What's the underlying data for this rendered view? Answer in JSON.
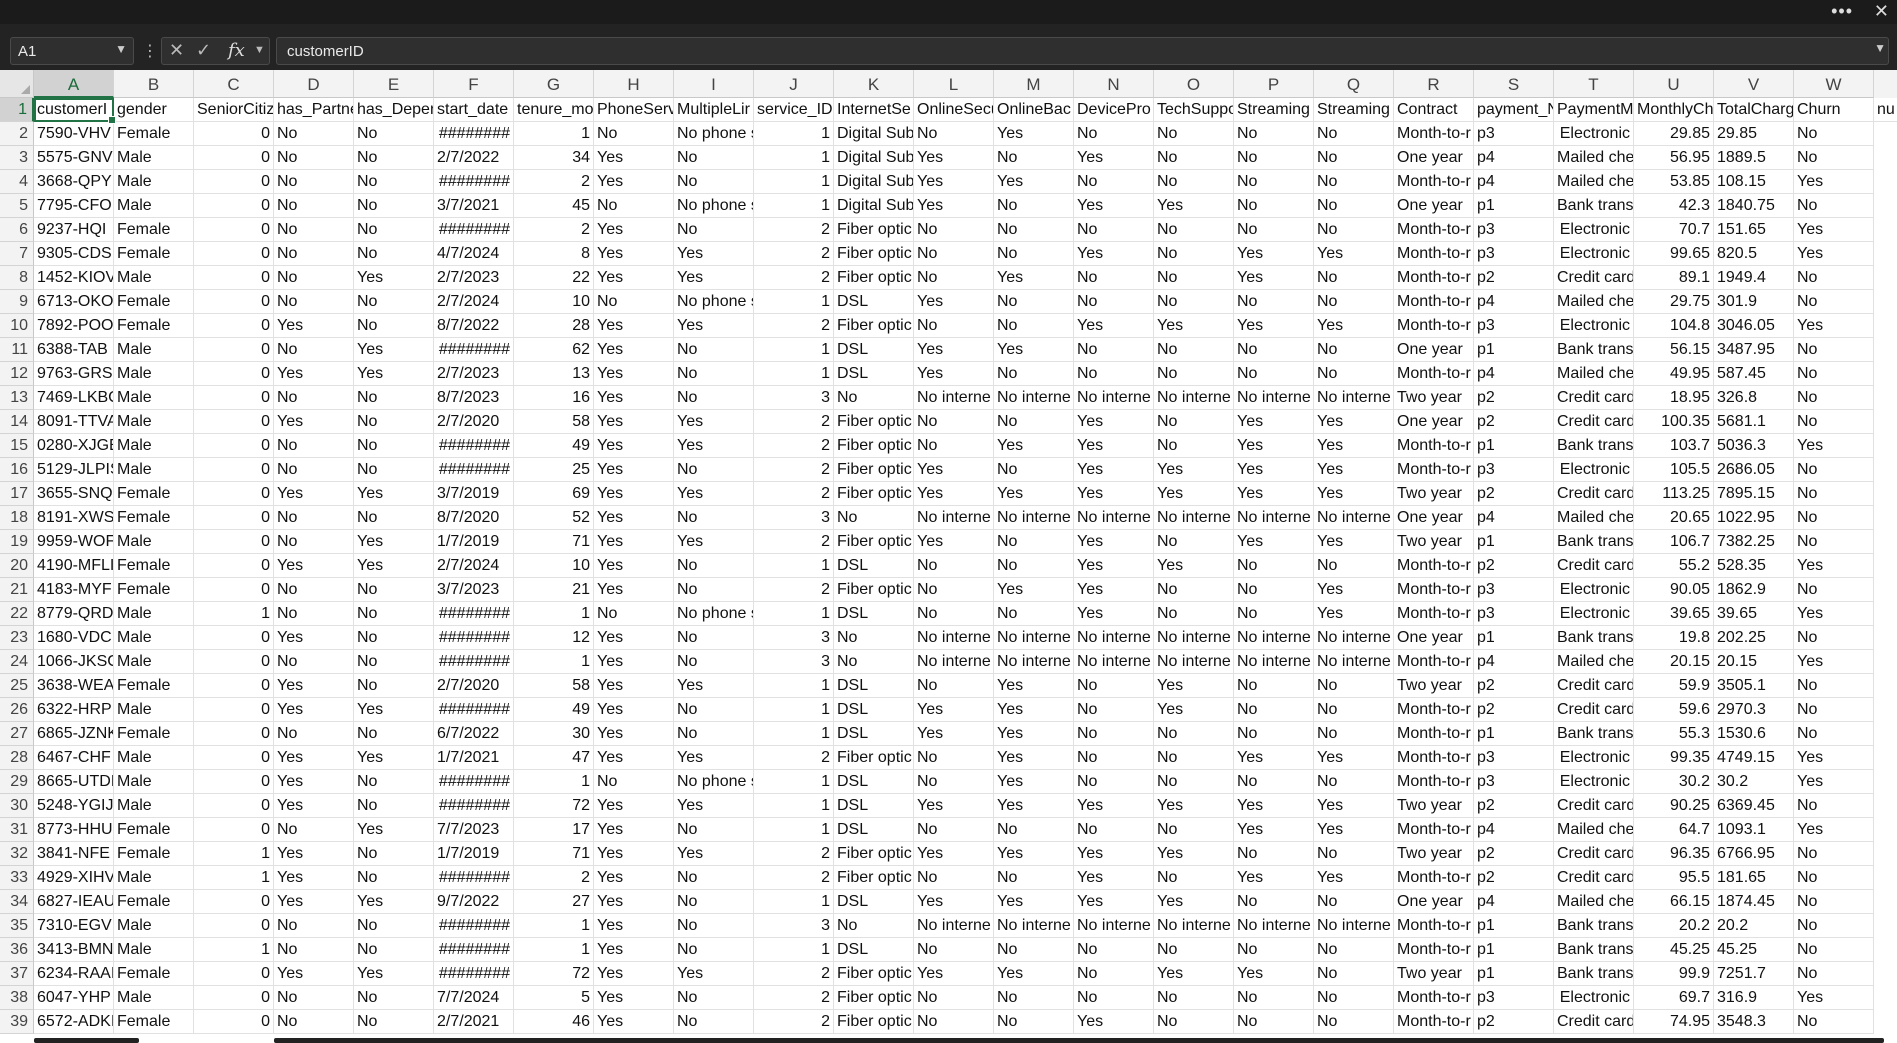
{
  "window": {
    "more_label": "•••",
    "close_label": "✕"
  },
  "formula_bar": {
    "name_box": "A1",
    "cancel_icon": "x-icon",
    "enter_icon": "check-icon",
    "function_label": "fx",
    "value": "customerID"
  },
  "columns": [
    "A",
    "B",
    "C",
    "D",
    "E",
    "F",
    "G",
    "H",
    "I",
    "J",
    "K",
    "L",
    "M",
    "N",
    "O",
    "P",
    "Q",
    "R",
    "S",
    "T",
    "U",
    "V",
    "W"
  ],
  "numeric_columns": [
    2,
    6,
    9,
    19,
    20
  ],
  "rows": [
    [
      "customerI",
      "gender",
      "SeniorCitiz",
      "has_Partne",
      "has_Deper",
      "start_date",
      "tenure_mo",
      "PhoneServ",
      "MultipleLir",
      "service_ID",
      "InternetSe",
      "OnlineSecu",
      "OnlineBac",
      "DevicePro",
      "TechSuppo",
      "Streaming",
      "Streaming",
      "Contract",
      "payment_N",
      "PaymentM",
      "MonthlyCh",
      "TotalCharg",
      "Churn",
      "nu"
    ],
    [
      "7590-VHV",
      "Female",
      "0",
      "No",
      "No",
      "########",
      "1",
      "No",
      "No phone s",
      "1",
      "Digital Sub",
      "No",
      "Yes",
      "No",
      "No",
      "No",
      "No",
      "Month-to-r",
      "p3",
      "Electronic",
      "29.85",
      "29.85",
      "No"
    ],
    [
      "5575-GNV",
      "Male",
      "0",
      "No",
      "No",
      "2/7/2022",
      "34",
      "Yes",
      "No",
      "1",
      "Digital Sub",
      "Yes",
      "No",
      "Yes",
      "No",
      "No",
      "No",
      "One year",
      "p4",
      "Mailed che",
      "56.95",
      "1889.5",
      "No"
    ],
    [
      "3668-QPYI",
      "Male",
      "0",
      "No",
      "No",
      "########",
      "2",
      "Yes",
      "No",
      "1",
      "Digital Sub",
      "Yes",
      "Yes",
      "No",
      "No",
      "No",
      "No",
      "Month-to-r",
      "p4",
      "Mailed che",
      "53.85",
      "108.15",
      "Yes"
    ],
    [
      "7795-CFO",
      "Male",
      "0",
      "No",
      "No",
      "3/7/2021",
      "45",
      "No",
      "No phone s",
      "1",
      "Digital Sub",
      "Yes",
      "No",
      "Yes",
      "Yes",
      "No",
      "No",
      "One year",
      "p1",
      "Bank trans",
      "42.3",
      "1840.75",
      "No"
    ],
    [
      "9237-HQI",
      "Female",
      "0",
      "No",
      "No",
      "########",
      "2",
      "Yes",
      "No",
      "2",
      "Fiber optic",
      "No",
      "No",
      "No",
      "No",
      "No",
      "No",
      "Month-to-r",
      "p3",
      "Electronic",
      "70.7",
      "151.65",
      "Yes"
    ],
    [
      "9305-CDSI",
      "Female",
      "0",
      "No",
      "No",
      "4/7/2024",
      "8",
      "Yes",
      "Yes",
      "2",
      "Fiber optic",
      "No",
      "No",
      "Yes",
      "No",
      "Yes",
      "Yes",
      "Month-to-r",
      "p3",
      "Electronic",
      "99.65",
      "820.5",
      "Yes"
    ],
    [
      "1452-KIOV",
      "Male",
      "0",
      "No",
      "Yes",
      "2/7/2023",
      "22",
      "Yes",
      "Yes",
      "2",
      "Fiber optic",
      "No",
      "Yes",
      "No",
      "No",
      "Yes",
      "No",
      "Month-to-r",
      "p2",
      "Credit card",
      "89.1",
      "1949.4",
      "No"
    ],
    [
      "6713-OKO",
      "Female",
      "0",
      "No",
      "No",
      "2/7/2024",
      "10",
      "No",
      "No phone s",
      "1",
      "DSL",
      "Yes",
      "No",
      "No",
      "No",
      "No",
      "No",
      "Month-to-r",
      "p4",
      "Mailed che",
      "29.75",
      "301.9",
      "No"
    ],
    [
      "7892-POO",
      "Female",
      "0",
      "Yes",
      "No",
      "8/7/2022",
      "28",
      "Yes",
      "Yes",
      "2",
      "Fiber optic",
      "No",
      "No",
      "Yes",
      "Yes",
      "Yes",
      "Yes",
      "Month-to-r",
      "p3",
      "Electronic",
      "104.8",
      "3046.05",
      "Yes"
    ],
    [
      "6388-TAB",
      "Male",
      "0",
      "No",
      "Yes",
      "########",
      "62",
      "Yes",
      "No",
      "1",
      "DSL",
      "Yes",
      "Yes",
      "No",
      "No",
      "No",
      "No",
      "One year",
      "p1",
      "Bank trans",
      "56.15",
      "3487.95",
      "No"
    ],
    [
      "9763-GRSI",
      "Male",
      "0",
      "Yes",
      "Yes",
      "2/7/2023",
      "13",
      "Yes",
      "No",
      "1",
      "DSL",
      "Yes",
      "No",
      "No",
      "No",
      "No",
      "No",
      "Month-to-r",
      "p4",
      "Mailed che",
      "49.95",
      "587.45",
      "No"
    ],
    [
      "7469-LKBC",
      "Male",
      "0",
      "No",
      "No",
      "8/7/2023",
      "16",
      "Yes",
      "No",
      "3",
      "No",
      "No interne",
      "No interne",
      "No interne",
      "No interne",
      "No interne",
      "No interne",
      "Two year",
      "p2",
      "Credit card",
      "18.95",
      "326.8",
      "No"
    ],
    [
      "8091-TTVA",
      "Male",
      "0",
      "Yes",
      "No",
      "2/7/2020",
      "58",
      "Yes",
      "Yes",
      "2",
      "Fiber optic",
      "No",
      "No",
      "Yes",
      "No",
      "Yes",
      "Yes",
      "One year",
      "p2",
      "Credit card",
      "100.35",
      "5681.1",
      "No"
    ],
    [
      "0280-XJGE",
      "Male",
      "0",
      "No",
      "No",
      "########",
      "49",
      "Yes",
      "Yes",
      "2",
      "Fiber optic",
      "No",
      "Yes",
      "Yes",
      "No",
      "Yes",
      "Yes",
      "Month-to-r",
      "p1",
      "Bank trans",
      "103.7",
      "5036.3",
      "Yes"
    ],
    [
      "5129-JLPIS",
      "Male",
      "0",
      "No",
      "No",
      "########",
      "25",
      "Yes",
      "No",
      "2",
      "Fiber optic",
      "Yes",
      "No",
      "Yes",
      "Yes",
      "Yes",
      "Yes",
      "Month-to-r",
      "p3",
      "Electronic",
      "105.5",
      "2686.05",
      "No"
    ],
    [
      "3655-SNQ",
      "Female",
      "0",
      "Yes",
      "Yes",
      "3/7/2019",
      "69",
      "Yes",
      "Yes",
      "2",
      "Fiber optic",
      "Yes",
      "Yes",
      "Yes",
      "Yes",
      "Yes",
      "Yes",
      "Two year",
      "p2",
      "Credit card",
      "113.25",
      "7895.15",
      "No"
    ],
    [
      "8191-XWS",
      "Female",
      "0",
      "No",
      "No",
      "8/7/2020",
      "52",
      "Yes",
      "No",
      "3",
      "No",
      "No interne",
      "No interne",
      "No interne",
      "No interne",
      "No interne",
      "No interne",
      "One year",
      "p4",
      "Mailed che",
      "20.65",
      "1022.95",
      "No"
    ],
    [
      "9959-WOF",
      "Male",
      "0",
      "No",
      "Yes",
      "1/7/2019",
      "71",
      "Yes",
      "Yes",
      "2",
      "Fiber optic",
      "Yes",
      "No",
      "Yes",
      "No",
      "Yes",
      "Yes",
      "Two year",
      "p1",
      "Bank trans",
      "106.7",
      "7382.25",
      "No"
    ],
    [
      "4190-MFLI",
      "Female",
      "0",
      "Yes",
      "Yes",
      "2/7/2024",
      "10",
      "Yes",
      "No",
      "1",
      "DSL",
      "No",
      "No",
      "Yes",
      "Yes",
      "No",
      "No",
      "Month-to-r",
      "p2",
      "Credit card",
      "55.2",
      "528.35",
      "Yes"
    ],
    [
      "4183-MYFI",
      "Female",
      "0",
      "No",
      "No",
      "3/7/2023",
      "21",
      "Yes",
      "No",
      "2",
      "Fiber optic",
      "No",
      "Yes",
      "Yes",
      "No",
      "No",
      "Yes",
      "Month-to-r",
      "p3",
      "Electronic",
      "90.05",
      "1862.9",
      "No"
    ],
    [
      "8779-QRD",
      "Male",
      "1",
      "No",
      "No",
      "########",
      "1",
      "No",
      "No phone s",
      "1",
      "DSL",
      "No",
      "No",
      "Yes",
      "No",
      "No",
      "Yes",
      "Month-to-r",
      "p3",
      "Electronic",
      "39.65",
      "39.65",
      "Yes"
    ],
    [
      "1680-VDC",
      "Male",
      "0",
      "Yes",
      "No",
      "########",
      "12",
      "Yes",
      "No",
      "3",
      "No",
      "No interne",
      "No interne",
      "No interne",
      "No interne",
      "No interne",
      "No interne",
      "One year",
      "p1",
      "Bank trans",
      "19.8",
      "202.25",
      "No"
    ],
    [
      "1066-JKSG",
      "Male",
      "0",
      "No",
      "No",
      "########",
      "1",
      "Yes",
      "No",
      "3",
      "No",
      "No interne",
      "No interne",
      "No interne",
      "No interne",
      "No interne",
      "No interne",
      "Month-to-r",
      "p4",
      "Mailed che",
      "20.15",
      "20.15",
      "Yes"
    ],
    [
      "3638-WEA",
      "Female",
      "0",
      "Yes",
      "No",
      "2/7/2020",
      "58",
      "Yes",
      "Yes",
      "1",
      "DSL",
      "No",
      "Yes",
      "No",
      "Yes",
      "No",
      "No",
      "Two year",
      "p2",
      "Credit card",
      "59.9",
      "3505.1",
      "No"
    ],
    [
      "6322-HRP",
      "Male",
      "0",
      "Yes",
      "Yes",
      "########",
      "49",
      "Yes",
      "No",
      "1",
      "DSL",
      "Yes",
      "Yes",
      "No",
      "Yes",
      "No",
      "No",
      "Month-to-r",
      "p2",
      "Credit card",
      "59.6",
      "2970.3",
      "No"
    ],
    [
      "6865-JZNK",
      "Female",
      "0",
      "No",
      "No",
      "6/7/2022",
      "30",
      "Yes",
      "No",
      "1",
      "DSL",
      "Yes",
      "Yes",
      "No",
      "No",
      "No",
      "No",
      "Month-to-r",
      "p1",
      "Bank trans",
      "55.3",
      "1530.6",
      "No"
    ],
    [
      "6467-CHF",
      "Male",
      "0",
      "Yes",
      "Yes",
      "1/7/2021",
      "47",
      "Yes",
      "Yes",
      "2",
      "Fiber optic",
      "No",
      "Yes",
      "No",
      "No",
      "Yes",
      "Yes",
      "Month-to-r",
      "p3",
      "Electronic",
      "99.35",
      "4749.15",
      "Yes"
    ],
    [
      "8665-UTDI",
      "Male",
      "0",
      "Yes",
      "No",
      "########",
      "1",
      "No",
      "No phone s",
      "1",
      "DSL",
      "No",
      "Yes",
      "No",
      "No",
      "No",
      "No",
      "Month-to-r",
      "p3",
      "Electronic",
      "30.2",
      "30.2",
      "Yes"
    ],
    [
      "5248-YGIJ",
      "Male",
      "0",
      "Yes",
      "No",
      "########",
      "72",
      "Yes",
      "Yes",
      "1",
      "DSL",
      "Yes",
      "Yes",
      "Yes",
      "Yes",
      "Yes",
      "Yes",
      "Two year",
      "p2",
      "Credit card",
      "90.25",
      "6369.45",
      "No"
    ],
    [
      "8773-HHU",
      "Female",
      "0",
      "No",
      "Yes",
      "7/7/2023",
      "17",
      "Yes",
      "No",
      "1",
      "DSL",
      "No",
      "No",
      "No",
      "No",
      "Yes",
      "Yes",
      "Month-to-r",
      "p4",
      "Mailed che",
      "64.7",
      "1093.1",
      "Yes"
    ],
    [
      "3841-NFE",
      "Female",
      "1",
      "Yes",
      "No",
      "1/7/2019",
      "71",
      "Yes",
      "Yes",
      "2",
      "Fiber optic",
      "Yes",
      "Yes",
      "Yes",
      "Yes",
      "No",
      "No",
      "Two year",
      "p2",
      "Credit card",
      "96.35",
      "6766.95",
      "No"
    ],
    [
      "4929-XIHV",
      "Male",
      "1",
      "Yes",
      "No",
      "########",
      "2",
      "Yes",
      "No",
      "2",
      "Fiber optic",
      "No",
      "No",
      "Yes",
      "No",
      "Yes",
      "Yes",
      "Month-to-r",
      "p2",
      "Credit card",
      "95.5",
      "181.65",
      "No"
    ],
    [
      "6827-IEAU",
      "Female",
      "0",
      "Yes",
      "Yes",
      "9/7/2022",
      "27",
      "Yes",
      "No",
      "1",
      "DSL",
      "Yes",
      "Yes",
      "Yes",
      "Yes",
      "No",
      "No",
      "One year",
      "p4",
      "Mailed che",
      "66.15",
      "1874.45",
      "No"
    ],
    [
      "7310-EGVI",
      "Male",
      "0",
      "No",
      "No",
      "########",
      "1",
      "Yes",
      "No",
      "3",
      "No",
      "No interne",
      "No interne",
      "No interne",
      "No interne",
      "No interne",
      "No interne",
      "Month-to-r",
      "p1",
      "Bank trans",
      "20.2",
      "20.2",
      "No"
    ],
    [
      "3413-BMN",
      "Male",
      "1",
      "No",
      "No",
      "########",
      "1",
      "Yes",
      "No",
      "1",
      "DSL",
      "No",
      "No",
      "No",
      "No",
      "No",
      "No",
      "Month-to-r",
      "p1",
      "Bank trans",
      "45.25",
      "45.25",
      "No"
    ],
    [
      "6234-RAAI",
      "Female",
      "0",
      "Yes",
      "Yes",
      "########",
      "72",
      "Yes",
      "Yes",
      "2",
      "Fiber optic",
      "Yes",
      "Yes",
      "No",
      "Yes",
      "Yes",
      "No",
      "Two year",
      "p1",
      "Bank trans",
      "99.9",
      "7251.7",
      "No"
    ],
    [
      "6047-YHP",
      "Male",
      "0",
      "No",
      "No",
      "7/7/2024",
      "5",
      "Yes",
      "No",
      "2",
      "Fiber optic",
      "No",
      "No",
      "No",
      "No",
      "No",
      "No",
      "Month-to-r",
      "p3",
      "Electronic",
      "69.7",
      "316.9",
      "Yes"
    ],
    [
      "6572-ADKI",
      "Female",
      "0",
      "No",
      "No",
      "2/7/2021",
      "46",
      "Yes",
      "No",
      "2",
      "Fiber optic",
      "No",
      "No",
      "Yes",
      "No",
      "No",
      "No",
      "Month-to-r",
      "p2",
      "Credit card",
      "74.95",
      "3548.3",
      "No"
    ]
  ]
}
